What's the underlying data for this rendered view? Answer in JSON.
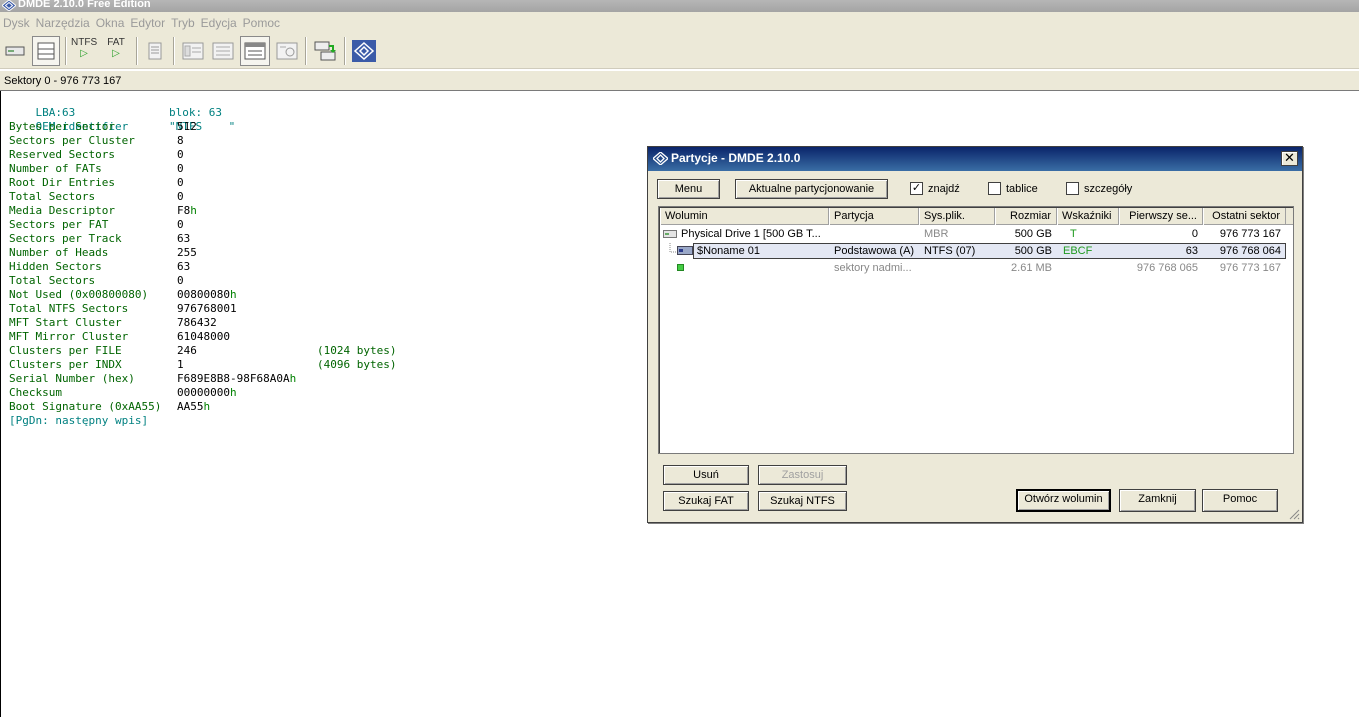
{
  "window": {
    "title": "DMDE 2.10.0 Free Edition"
  },
  "menu": [
    "Dysk",
    "Narzędzia",
    "Okna",
    "Edytor",
    "Tryb",
    "Edycja",
    "Pomoc"
  ],
  "toolbar": {
    "ntfs_label": "NTFS",
    "fat_label": "FAT",
    "play_glyph": "▷"
  },
  "status": {
    "sectors": "Sektory 0 - 976 773 167"
  },
  "dump": {
    "lba": "LBA:63",
    "blok": "blok: 63",
    "oem_key": "OEM identifier",
    "oem_val": "\"NTFS    \"",
    "fields": [
      {
        "key": "Bytes per Sector",
        "val": "512"
      },
      {
        "key": "Sectors per Cluster",
        "val": "8"
      },
      {
        "key": "Reserved Sectors",
        "val": "0"
      },
      {
        "key": "Number of FATs",
        "val": "0"
      },
      {
        "key": "Root Dir Entries",
        "val": "0"
      },
      {
        "key": "Total Sectors",
        "val": "0"
      },
      {
        "key": "Media Descriptor",
        "val": "F8",
        "suffix": "h"
      },
      {
        "key": "Sectors per FAT",
        "val": "0"
      },
      {
        "key": "Sectors per Track",
        "val": "63"
      },
      {
        "key": "Number of Heads",
        "val": "255"
      },
      {
        "key": "Hidden Sectors",
        "val": "63"
      },
      {
        "key": "Total Sectors",
        "val": "0"
      },
      {
        "key": "Not Used (0x00800080)",
        "val": "00800080",
        "suffix": "h"
      },
      {
        "key": "Total NTFS Sectors",
        "val": "976768001"
      },
      {
        "key": "MFT Start Cluster",
        "val": "786432"
      },
      {
        "key": "MFT Mirror Cluster",
        "val": "61048000"
      },
      {
        "key": "Clusters per FILE",
        "val": "246",
        "extra": "(1024 bytes)"
      },
      {
        "key": "Clusters per INDX",
        "val": "1",
        "extra": "(4096 bytes)"
      },
      {
        "key": "Serial Number (hex)",
        "val": "F689E8B8-98F68A0A",
        "suffix": "h"
      },
      {
        "key": "Checksum",
        "val": "00000000",
        "suffix": "h"
      },
      {
        "key": "Boot Signature (0xAA55)",
        "val": "AA55",
        "suffix": "h"
      }
    ],
    "footer": "[PgDn: następny wpis]"
  },
  "dialog": {
    "title": "Partycje - DMDE 2.10.0",
    "close_glyph": "✕",
    "menu_button": "Menu",
    "current_partitioning_button": "Aktualne partycjonowanie",
    "check_znajdz": {
      "label": "znajdź",
      "checked": "✓"
    },
    "check_tablice": {
      "label": "tablice"
    },
    "check_szczegoly": {
      "label": "szczegóły"
    },
    "columns": [
      "Wolumin",
      "Partycja",
      "Sys.plik.",
      "Rozmiar",
      "Wskaźniki",
      "Pierwszy se...",
      "Ostatni sektor"
    ],
    "rows": [
      {
        "volume": "Physical Drive 1 [500 GB T...",
        "partition": "",
        "fs": "MBR",
        "size": "500 GB",
        "flags": "T",
        "first": "0",
        "last": "976 773 167"
      },
      {
        "volume": "$Noname 01",
        "partition": "Podstawowa (A)",
        "fs": "NTFS (07)",
        "size": "500 GB",
        "flags": "EBCF",
        "first": "63",
        "last": "976 768 064"
      },
      {
        "volume": "",
        "partition": "sektory nadmi...",
        "fs": "",
        "size": "2.61 MB",
        "flags": "",
        "first": "976 768 065",
        "last": "976 773 167"
      }
    ],
    "buttons": {
      "usun": "Usuń",
      "zastosuj": "Zastosuj",
      "szukaj_fat": "Szukaj FAT",
      "szukaj_ntfs": "Szukaj NTFS",
      "otworz": "Otwórz wolumin",
      "zamknij": "Zamknij",
      "pomoc": "Pomoc"
    }
  }
}
